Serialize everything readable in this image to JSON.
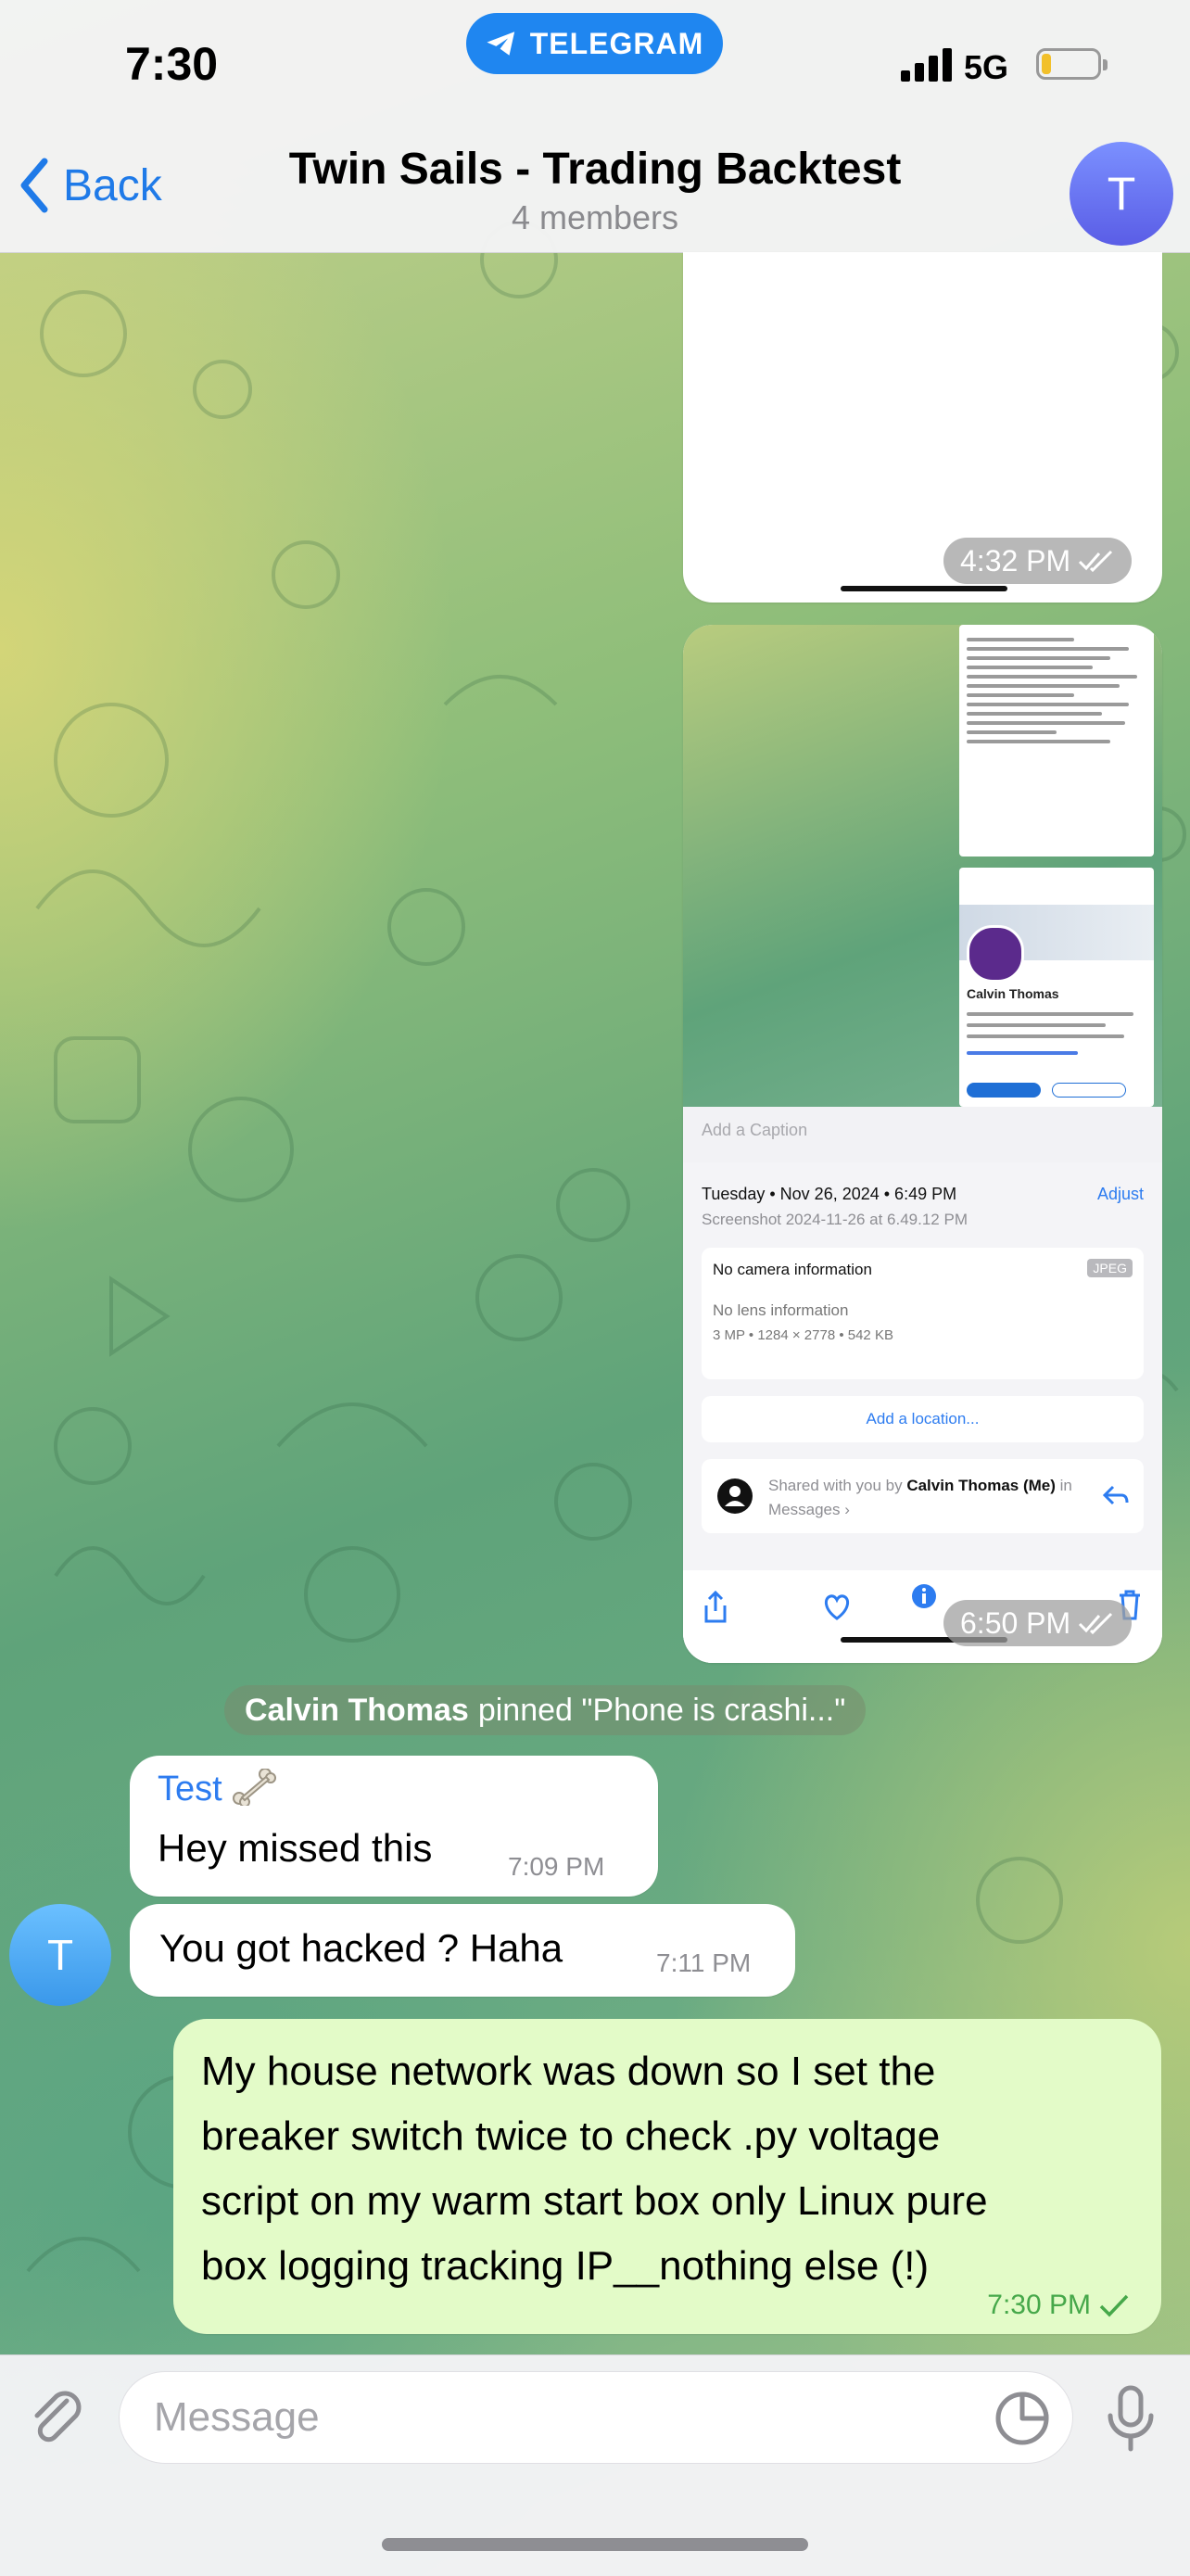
{
  "status_bar": {
    "time": "7:30",
    "app_pill": "TELEGRAM",
    "network": "5G"
  },
  "header": {
    "back_label": "Back",
    "title": "Twin Sails - Trading Backtest",
    "subtitle": "4 members",
    "avatar_letter": "T"
  },
  "messages": {
    "media1_time": "4:32 PM",
    "media2": {
      "profile_name": "Calvin Thomas",
      "caption_placeholder": "Add a Caption",
      "date": "Tuesday • Nov 26, 2024 • 6:49 PM",
      "adjust": "Adjust",
      "screenshot_name": "Screenshot 2024-11-26 at 6.49.12 PM",
      "camera": "No camera information",
      "format": "JPEG",
      "lens": "No lens information",
      "meta": "3 MP • 1284 × 2778 • 542 KB",
      "location": "Add a location...",
      "shared_prefix": "Shared with you by",
      "shared_name": "Calvin Thomas (Me)",
      "shared_suffix": "in Messages ›",
      "time": "6:50 PM"
    },
    "service": {
      "actor": "Calvin Thomas",
      "text": "pinned \"Phone is crashi...\""
    },
    "incoming1": {
      "sender": "Test",
      "text": "Hey missed this",
      "time": "7:09 PM"
    },
    "incoming2": {
      "text": "You got hacked ? Haha",
      "time": "7:11 PM",
      "avatar_letter": "T"
    },
    "outgoing": {
      "text": "My house network was down so I set the\nbreaker switch twice to check .py voltage\nscript on my warm start box only Linux pure\nbox logging tracking IP__nothing else (!)",
      "time": "7:30 PM"
    }
  },
  "input": {
    "placeholder": "Message"
  },
  "colors": {
    "accent": "#2d7cf0",
    "outgoing_bubble": "#e3fbc8",
    "telegram_pill": "#1f86f0"
  }
}
